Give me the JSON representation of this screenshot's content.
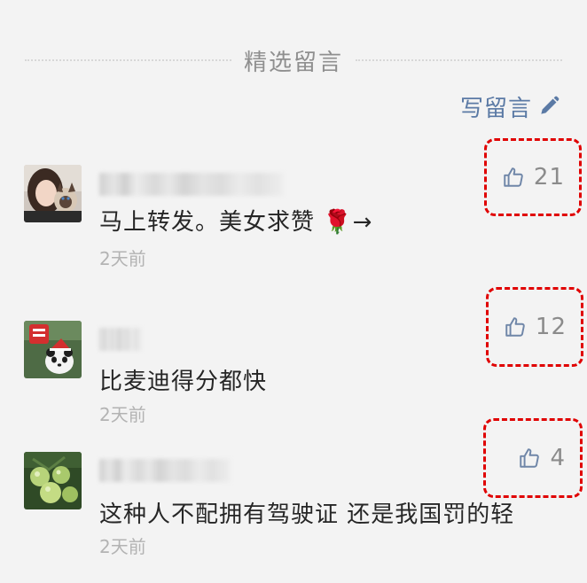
{
  "section": {
    "title": "精选留言"
  },
  "write_comment": {
    "label": "写留言"
  },
  "colors": {
    "link": "#5b7aa5",
    "highlight": "#e00000",
    "muted": "#b3b3b3"
  },
  "comments": [
    {
      "avatar_icon": "girl-with-cat-avatar",
      "nickname": "",
      "content": "马上转发。美女求赞 🌹→",
      "time": "2天前",
      "likes": "21"
    },
    {
      "avatar_icon": "panda-avatar",
      "nickname": "",
      "content": "比麦迪得分都快",
      "time": "2天前",
      "likes": "12"
    },
    {
      "avatar_icon": "tomato-avatar",
      "nickname": "",
      "content": "这种人不配拥有驾驶证 还是我国罚的轻",
      "time": "2天前",
      "likes": "4"
    }
  ]
}
